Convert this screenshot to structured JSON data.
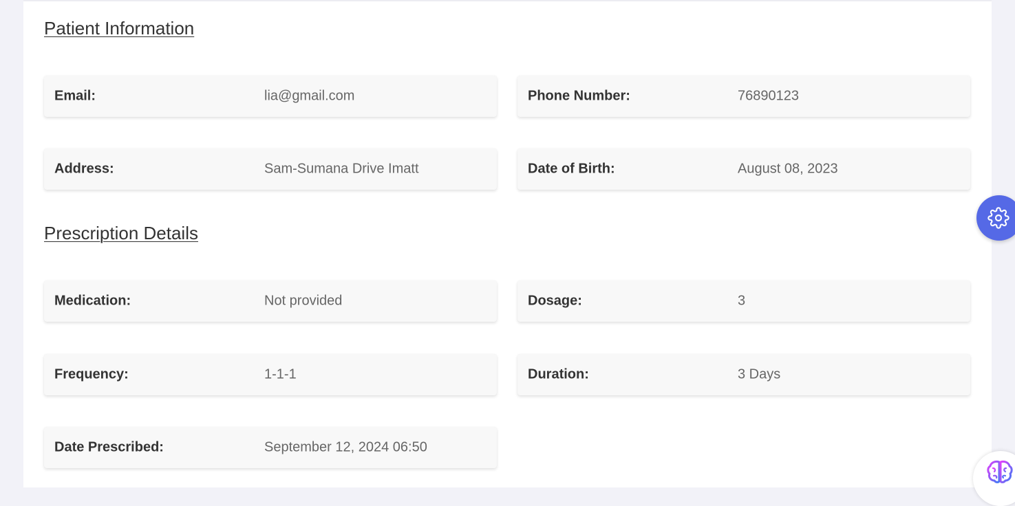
{
  "patient_information": {
    "title": "Patient Information",
    "fields": [
      {
        "label": "Email:",
        "value": "lia@gmail.com"
      },
      {
        "label": "Phone Number:",
        "value": "76890123"
      },
      {
        "label": "Address:",
        "value": "Sam-Sumana Drive Imatt"
      },
      {
        "label": "Date of Birth:",
        "value": "August 08, 2023"
      }
    ]
  },
  "prescription_details": {
    "title": "Prescription Details",
    "fields": [
      {
        "label": "Medication:",
        "value": "Not provided"
      },
      {
        "label": "Dosage:",
        "value": "3"
      },
      {
        "label": "Frequency:",
        "value": "1-1-1"
      },
      {
        "label": "Duration:",
        "value": "3 Days"
      },
      {
        "label": "Date Prescribed:",
        "value": "September 12, 2024 06:50"
      }
    ]
  },
  "floating_buttons": {
    "settings_icon": "gear-icon",
    "assistant_icon": "brain-icon"
  },
  "colors": {
    "accent": "#5569e6",
    "card_background": "#f8f8f8",
    "page_background": "#f2f2f8"
  }
}
